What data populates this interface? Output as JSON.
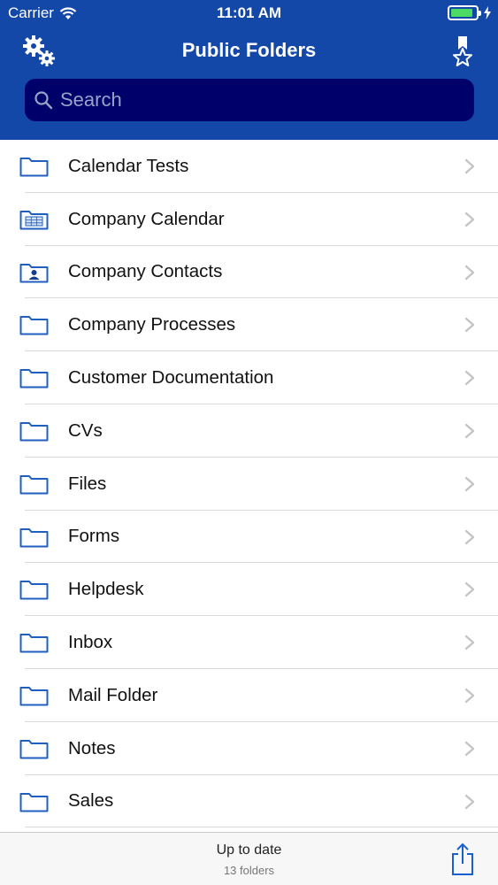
{
  "status_bar": {
    "carrier": "Carrier",
    "time": "11:01 AM",
    "battery_level": 0.9,
    "battery_color": "#4cd964",
    "icons": [
      "wifi-icon",
      "battery-icon",
      "charging-bolt-icon"
    ]
  },
  "nav": {
    "title": "Public Folders",
    "left_icon": "settings-gears-icon",
    "right_icon": "favorite-bookmark-icon",
    "background_color": "#1448a8"
  },
  "search": {
    "placeholder": "Search",
    "value": "",
    "background_color": "#00006b"
  },
  "folders": [
    {
      "label": "Calendar Tests",
      "icon": "folder-icon"
    },
    {
      "label": "Company Calendar",
      "icon": "calendar-folder-icon"
    },
    {
      "label": "Company Contacts",
      "icon": "contacts-folder-icon"
    },
    {
      "label": "Company Processes",
      "icon": "folder-icon"
    },
    {
      "label": "Customer Documentation",
      "icon": "folder-icon"
    },
    {
      "label": "CVs",
      "icon": "folder-icon"
    },
    {
      "label": "Files",
      "icon": "folder-icon"
    },
    {
      "label": "Forms",
      "icon": "folder-icon"
    },
    {
      "label": "Helpdesk",
      "icon": "folder-icon"
    },
    {
      "label": "Inbox",
      "icon": "folder-icon"
    },
    {
      "label": "Mail Folder",
      "icon": "folder-icon"
    },
    {
      "label": "Notes",
      "icon": "folder-icon"
    },
    {
      "label": "Sales",
      "icon": "folder-icon"
    }
  ],
  "footer": {
    "status": "Up to date",
    "count": "13 folders",
    "share_icon": "share-icon"
  }
}
